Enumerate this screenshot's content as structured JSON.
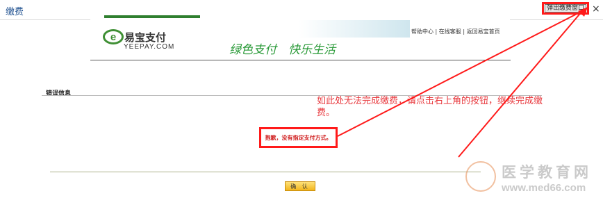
{
  "window": {
    "title": "缴费",
    "popout_label": "弹出缴费窗口",
    "close_symbol": "×"
  },
  "header": {
    "logo_text": "易宝支付",
    "logo_subtext": "YEEPAY.COM",
    "links": [
      "帮助中心",
      "在线客服",
      "返回易宝首页"
    ],
    "slogan": "绿色支付　快乐生活"
  },
  "content": {
    "section_heading": "错误信息",
    "error_message": "抱歉，没有指定支付方式。",
    "confirm_label": "确 认"
  },
  "annotation": {
    "text": "如此处无法完成缴费，请点击右上角的按钮，继续完成缴费。"
  },
  "watermark": {
    "title": "医学教育网",
    "url": "www.med66.com"
  },
  "colors": {
    "accent_red": "#ff1a1a",
    "brand_green": "#2f7f2f",
    "slogan_green": "#2a9a38"
  }
}
